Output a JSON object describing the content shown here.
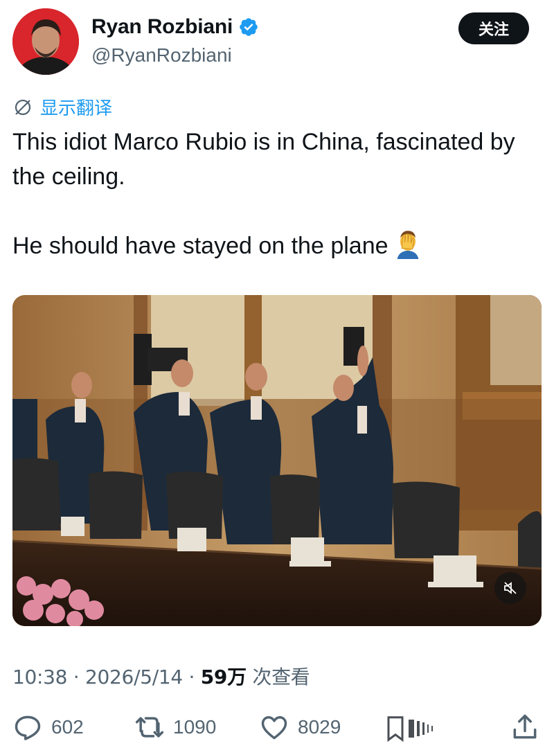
{
  "author": {
    "display_name": "Ryan Rozbiani",
    "handle": "@RyanRozbiani",
    "verified": true,
    "follow_label": "关注"
  },
  "translate_label": "显示翻译",
  "tweet": {
    "text": "This idiot Marco Rubio is in China, fascinated by the ceiling.\n\nHe should have stayed on the plane",
    "emoji": "man-facepalming"
  },
  "media": {
    "type": "video",
    "muted": true
  },
  "meta": {
    "time": "10:38",
    "date": "2026/5/14",
    "views_count": "59万",
    "views_label": "次查看"
  },
  "stats": {
    "replies": "602",
    "reposts": "1090",
    "likes": "8029"
  },
  "colors": {
    "accent": "#1d9bf0",
    "secondary_text": "#536471",
    "primary_text": "#0f1419"
  }
}
